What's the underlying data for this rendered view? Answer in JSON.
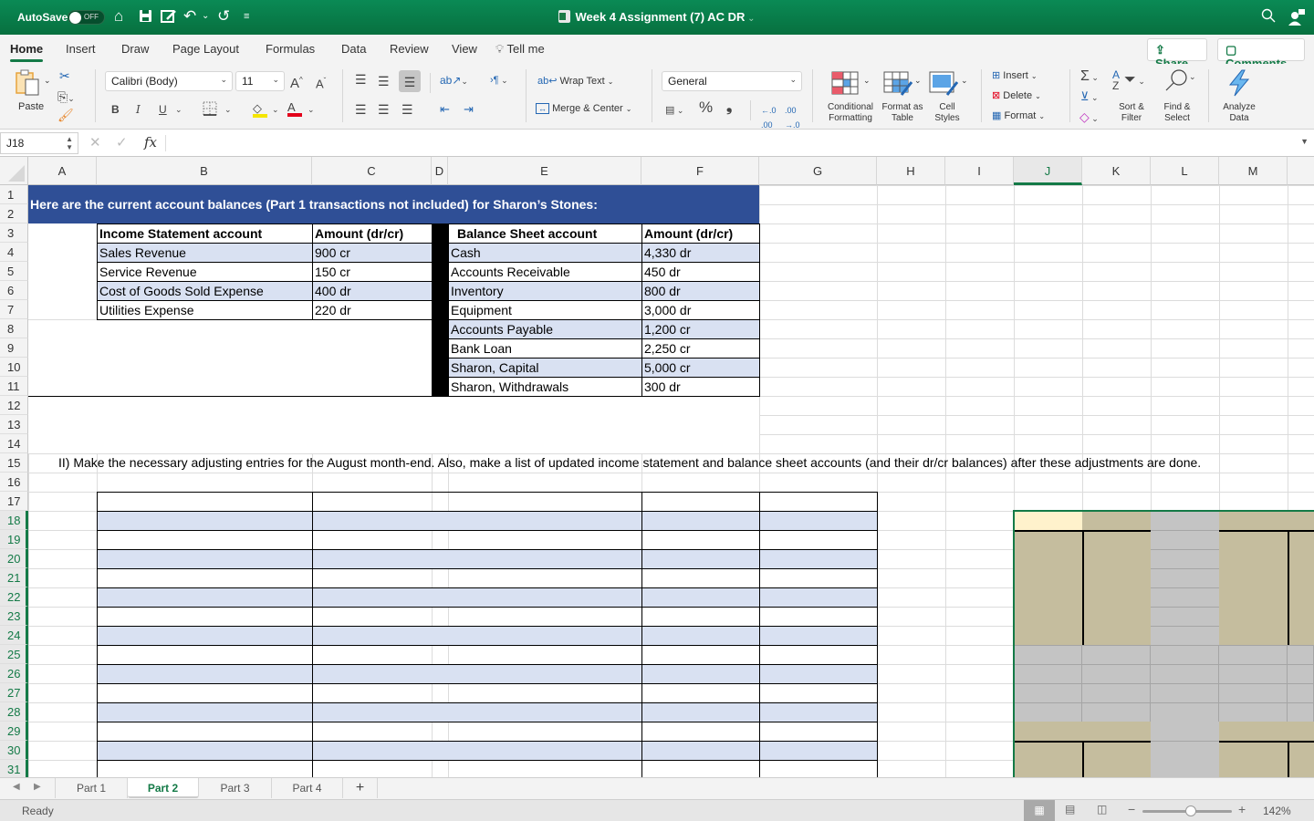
{
  "titlebar": {
    "autosave_label": "AutoSave",
    "autosave_state": "OFF",
    "document_title": "Week 4 Assignment (7) AC DR",
    "quick_access": [
      "home-icon",
      "save-icon",
      "edit-icon",
      "undo-icon",
      "redo-icon",
      "customize-icon"
    ]
  },
  "menu_tabs": [
    {
      "label": "Home",
      "active": true
    },
    {
      "label": "Insert"
    },
    {
      "label": "Draw"
    },
    {
      "label": "Page Layout"
    },
    {
      "label": "Formulas"
    },
    {
      "label": "Data"
    },
    {
      "label": "Review"
    },
    {
      "label": "View"
    },
    {
      "label": "Tell me"
    }
  ],
  "share_label": "Share",
  "comments_label": "Comments",
  "ribbon": {
    "paste_label": "Paste",
    "font_name": "Calibri (Body)",
    "font_size": "11",
    "bold": "B",
    "italic": "I",
    "underline": "U",
    "wrap_text": "Wrap Text",
    "merge_center": "Merge & Center",
    "number_format": "General",
    "percent": "%",
    "comma": "9",
    "conditional_formatting": "Conditional Formatting",
    "format_as_table": "Format as Table",
    "cell_styles": "Cell Styles",
    "insert": "Insert",
    "delete": "Delete",
    "format": "Format",
    "sort_filter": "Sort & Filter",
    "find_select": "Find & Select",
    "analyze_data": "Analyze Data",
    "colors": {
      "highlight": "#f5e600",
      "font_color": "#e3001b"
    }
  },
  "formula_bar": {
    "name_box": "J18",
    "fx": "fx",
    "formula": ""
  },
  "columns": [
    "A",
    "B",
    "C",
    "D",
    "E",
    "F",
    "G",
    "H",
    "I",
    "J",
    "K",
    "L",
    "M"
  ],
  "rows": [
    "1",
    "2",
    "3",
    "4",
    "5",
    "6",
    "7",
    "8",
    "9",
    "10",
    "11",
    "12",
    "13",
    "14",
    "15",
    "16",
    "17",
    "18",
    "19",
    "20",
    "21",
    "22",
    "23",
    "24",
    "25",
    "26",
    "27",
    "28",
    "29",
    "30",
    "31"
  ],
  "selected_cell": "J18",
  "sheet": {
    "banner": "Here are the current account balances (Part 1 transactions not included) for Sharon’s Stones:",
    "income_statement": {
      "headers": [
        "Income Statement account",
        "Amount (dr/cr)"
      ],
      "rows": [
        [
          "Sales Revenue",
          "900 cr"
        ],
        [
          "Service Revenue",
          "150 cr"
        ],
        [
          "Cost of Goods Sold Expense",
          "400 dr"
        ],
        [
          "Utilities Expense",
          "220 dr"
        ]
      ]
    },
    "balance_sheet": {
      "headers": [
        "Balance Sheet account",
        "Amount (dr/cr)"
      ],
      "rows": [
        [
          "Cash",
          "4,330 dr"
        ],
        [
          "Accounts Receivable",
          "450 dr"
        ],
        [
          "Inventory",
          "800 dr"
        ],
        [
          "Equipment",
          "3,000 dr"
        ],
        [
          "Accounts Payable",
          "1,200 cr"
        ],
        [
          "Bank Loan",
          "2,250 cr"
        ],
        [
          "Sharon, Capital",
          "5,000 cr"
        ],
        [
          "Sharon, Withdrawals",
          "300 dr"
        ]
      ]
    },
    "instruction": "II) Make the necessary adjusting entries for the August month-end. Also, make a list of updated income statement and balance sheet accounts (and their dr/cr balances) after these adjustments are done."
  },
  "sheet_tabs": [
    {
      "label": "Part 1"
    },
    {
      "label": "Part 2",
      "active": true
    },
    {
      "label": "Part 3"
    },
    {
      "label": "Part 4"
    }
  ],
  "add_sheet": "+",
  "status": {
    "text": "Ready",
    "zoom": "142%",
    "zoom_level_percent": 142
  }
}
